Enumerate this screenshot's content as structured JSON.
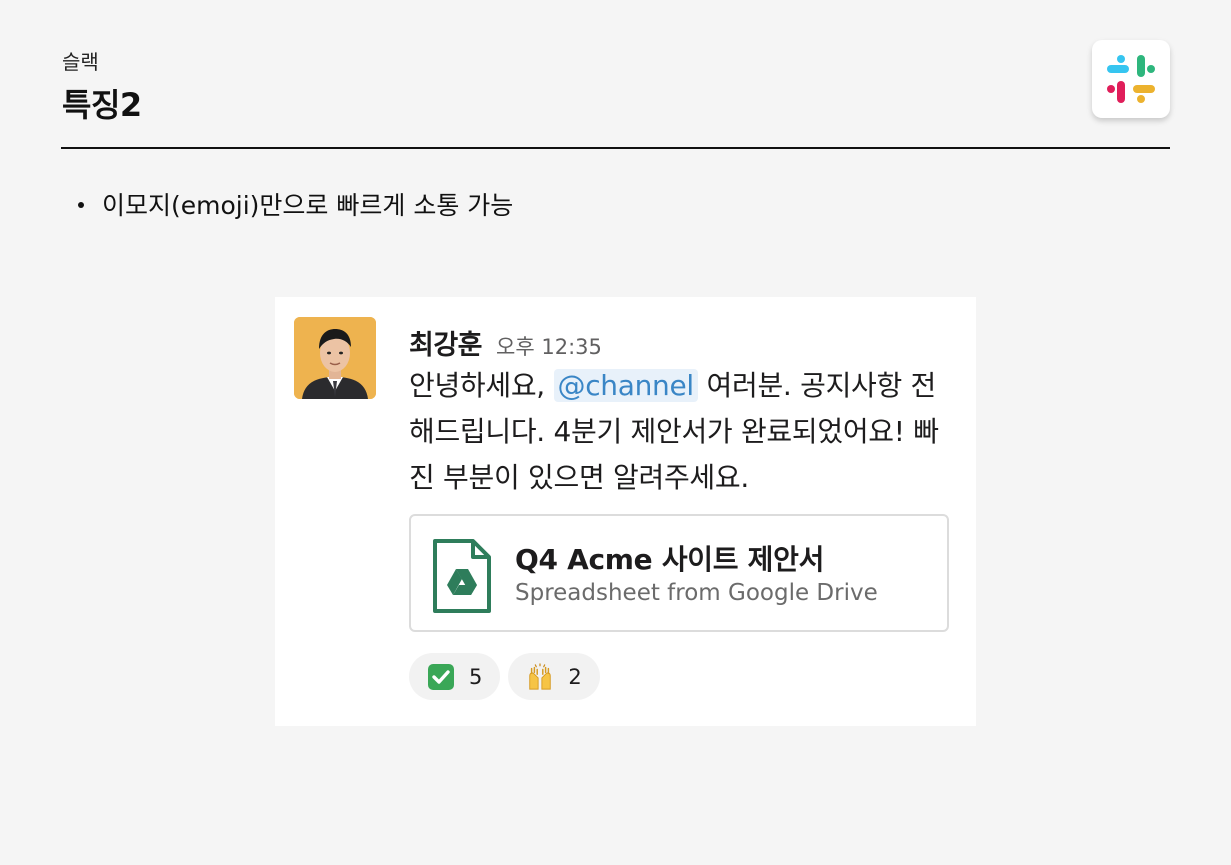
{
  "header": {
    "kicker": "슬랙",
    "title": "특징2"
  },
  "logo": {
    "icon": "slack-logo-icon"
  },
  "bullets": [
    {
      "text": "이모지(emoji)만으로 빠르게 소통 가능"
    }
  ],
  "message": {
    "sender": "최강훈",
    "time": "오후 12:35",
    "body_before": "안녕하세요, ",
    "mention": "@channel",
    "body_after": " 여러분. 공지사항 전해드립니다. 4분기 제안서가 완료되었어요! 빠진 부분이 있으면 알려주세요.",
    "attachment": {
      "title": "Q4 Acme 사이트 제안서",
      "subtitle": "Spreadsheet from Google Drive",
      "icon": "google-drive-file-icon"
    },
    "reactions": [
      {
        "emoji": "check-mark-icon",
        "count": "5"
      },
      {
        "emoji": "raising-hands-icon",
        "count": "2"
      }
    ]
  },
  "colors": {
    "mention_bg": "#e8f1fa",
    "mention_text": "#3a86c6",
    "drive_green": "#2e7d5b",
    "check_green": "#3aa757"
  }
}
